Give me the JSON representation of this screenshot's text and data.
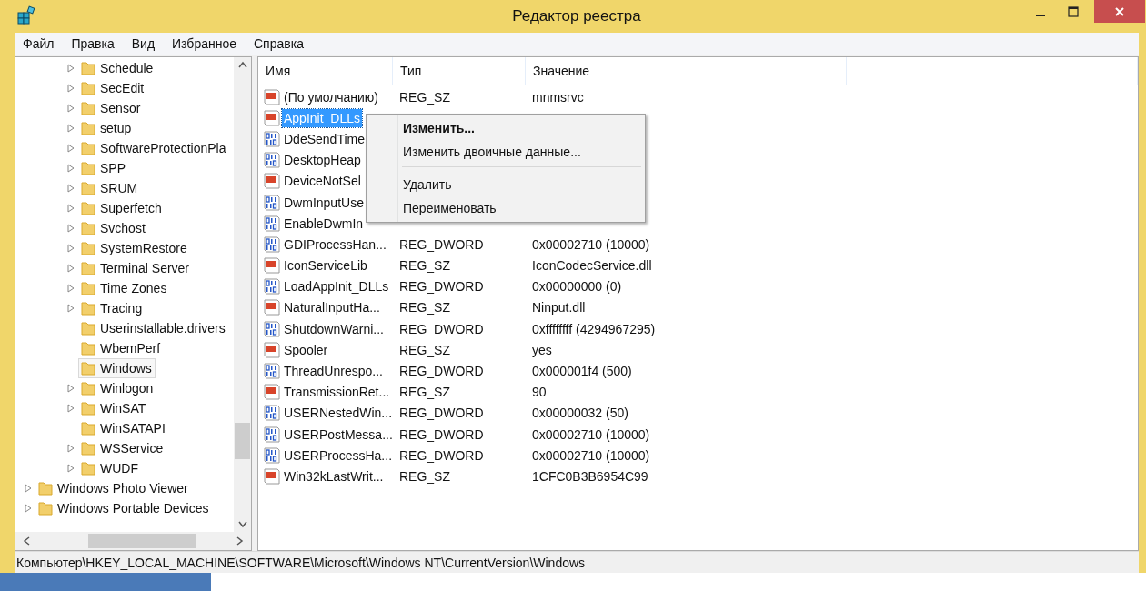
{
  "window": {
    "title": "Редактор реестра"
  },
  "menu": [
    "Файл",
    "Правка",
    "Вид",
    "Избранное",
    "Справка"
  ],
  "tree": {
    "subkeys": [
      {
        "label": "Schedule",
        "expandable": true,
        "selected": false
      },
      {
        "label": "SecEdit",
        "expandable": true,
        "selected": false
      },
      {
        "label": "Sensor",
        "expandable": true,
        "selected": false
      },
      {
        "label": "setup",
        "expandable": true,
        "selected": false
      },
      {
        "label": "SoftwareProtectionPla",
        "expandable": true,
        "selected": false
      },
      {
        "label": "SPP",
        "expandable": true,
        "selected": false
      },
      {
        "label": "SRUM",
        "expandable": true,
        "selected": false
      },
      {
        "label": "Superfetch",
        "expandable": true,
        "selected": false
      },
      {
        "label": "Svchost",
        "expandable": true,
        "selected": false
      },
      {
        "label": "SystemRestore",
        "expandable": true,
        "selected": false
      },
      {
        "label": "Terminal Server",
        "expandable": true,
        "selected": false
      },
      {
        "label": "Time Zones",
        "expandable": true,
        "selected": false
      },
      {
        "label": "Tracing",
        "expandable": true,
        "selected": false
      },
      {
        "label": "Userinstallable.drivers",
        "expandable": false,
        "selected": false
      },
      {
        "label": "WbemPerf",
        "expandable": false,
        "selected": false
      },
      {
        "label": "Windows",
        "expandable": false,
        "selected": true
      },
      {
        "label": "Winlogon",
        "expandable": true,
        "selected": false
      },
      {
        "label": "WinSAT",
        "expandable": true,
        "selected": false
      },
      {
        "label": "WinSATAPI",
        "expandable": false,
        "selected": false
      },
      {
        "label": "WSService",
        "expandable": true,
        "selected": false
      },
      {
        "label": "WUDF",
        "expandable": true,
        "selected": false
      }
    ],
    "keys": [
      {
        "label": "Windows Photo Viewer",
        "expandable": true,
        "selected": false
      },
      {
        "label": "Windows Portable Devices",
        "expandable": true,
        "selected": false
      }
    ]
  },
  "table": {
    "columns": [
      "Имя",
      "Тип",
      "Значение"
    ],
    "rows": [
      {
        "kind": "string",
        "name": "(По умолчанию)",
        "type": "REG_SZ",
        "value": "mnmsrvc",
        "selected": false
      },
      {
        "kind": "string",
        "name": "AppInit_DLLs",
        "selected": true
      },
      {
        "kind": "binary",
        "name": "DdeSendTime",
        "selected": false
      },
      {
        "kind": "binary",
        "name": "DesktopHeap",
        "selected": false
      },
      {
        "kind": "string",
        "name": "DeviceNotSel",
        "selected": false
      },
      {
        "kind": "binary",
        "name": "DwmInputUse",
        "selected": false
      },
      {
        "kind": "binary",
        "name": "EnableDwmIn",
        "selected": false
      },
      {
        "kind": "binary",
        "name": "GDIProcessHan...",
        "type": "REG_DWORD",
        "value": "0x00002710 (10000)",
        "selected": false
      },
      {
        "kind": "string",
        "name": "IconServiceLib",
        "type": "REG_SZ",
        "value": "IconCodecService.dll",
        "selected": false
      },
      {
        "kind": "binary",
        "name": "LoadAppInit_DLLs",
        "type": "REG_DWORD",
        "value": "0x00000000 (0)",
        "selected": false
      },
      {
        "kind": "string",
        "name": "NaturalInputHa...",
        "type": "REG_SZ",
        "value": "Ninput.dll",
        "selected": false
      },
      {
        "kind": "binary",
        "name": "ShutdownWarni...",
        "type": "REG_DWORD",
        "value": "0xffffffff (4294967295)",
        "selected": false
      },
      {
        "kind": "string",
        "name": "Spooler",
        "type": "REG_SZ",
        "value": "yes",
        "selected": false
      },
      {
        "kind": "binary",
        "name": "ThreadUnrespo...",
        "type": "REG_DWORD",
        "value": "0x000001f4 (500)",
        "selected": false
      },
      {
        "kind": "string",
        "name": "TransmissionRet...",
        "type": "REG_SZ",
        "value": "90",
        "selected": false
      },
      {
        "kind": "binary",
        "name": "USERNestedWin...",
        "type": "REG_DWORD",
        "value": "0x00000032 (50)",
        "selected": false
      },
      {
        "kind": "binary",
        "name": "USERPostMessa...",
        "type": "REG_DWORD",
        "value": "0x00002710 (10000)",
        "selected": false
      },
      {
        "kind": "binary",
        "name": "USERProcessHa...",
        "type": "REG_DWORD",
        "value": "0x00002710 (10000)",
        "selected": false
      },
      {
        "kind": "string",
        "name": "Win32kLastWrit...",
        "type": "REG_SZ",
        "value": "1CFC0B3B6954C99",
        "selected": false
      }
    ]
  },
  "context_menu": [
    {
      "kind": "default",
      "label": "Изменить..."
    },
    {
      "kind": "item",
      "label": "Изменить двоичные данные..."
    },
    {
      "kind": "separator"
    },
    {
      "kind": "item",
      "label": "Удалить"
    },
    {
      "kind": "item",
      "label": "Переименовать"
    }
  ],
  "status_bar": "Компьютер\\HKEY_LOCAL_MACHINE\\SOFTWARE\\Microsoft\\Windows NT\\CurrentVersion\\Windows"
}
